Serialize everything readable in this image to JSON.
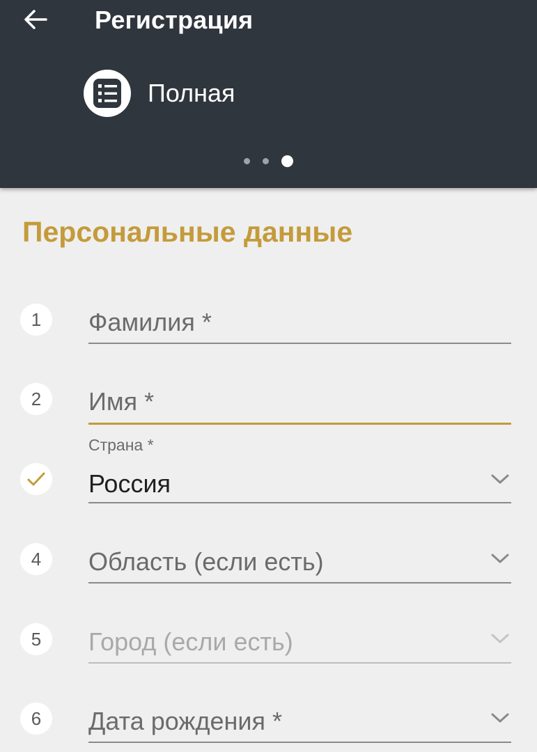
{
  "header": {
    "title": "Регистрация",
    "registration_type": "Полная",
    "pager": {
      "count": 3,
      "active_index": 2
    }
  },
  "section": {
    "title": "Персональные данные"
  },
  "fields": [
    {
      "step": "1",
      "label": "Фамилия *",
      "state": "empty"
    },
    {
      "step": "2",
      "label": "Имя *",
      "state": "focused"
    },
    {
      "step": "done",
      "label": "Страна *",
      "value": "Россия",
      "state": "filled",
      "dropdown": true
    },
    {
      "step": "4",
      "label": "Область (если есть)",
      "state": "empty",
      "dropdown": true
    },
    {
      "step": "5",
      "label": "Город (если есть)",
      "state": "disabled",
      "dropdown": true
    },
    {
      "step": "6",
      "label": "Дата рождения *",
      "state": "empty",
      "dropdown": true
    }
  ],
  "colors": {
    "header_bg": "#2f363d",
    "accent": "#c49b3b",
    "page_bg": "#efefef"
  },
  "icons": {
    "back": "arrow-left-icon",
    "registration_type": "list-icon",
    "completed_step": "checkmark-icon",
    "dropdown": "chevron-down-icon"
  }
}
